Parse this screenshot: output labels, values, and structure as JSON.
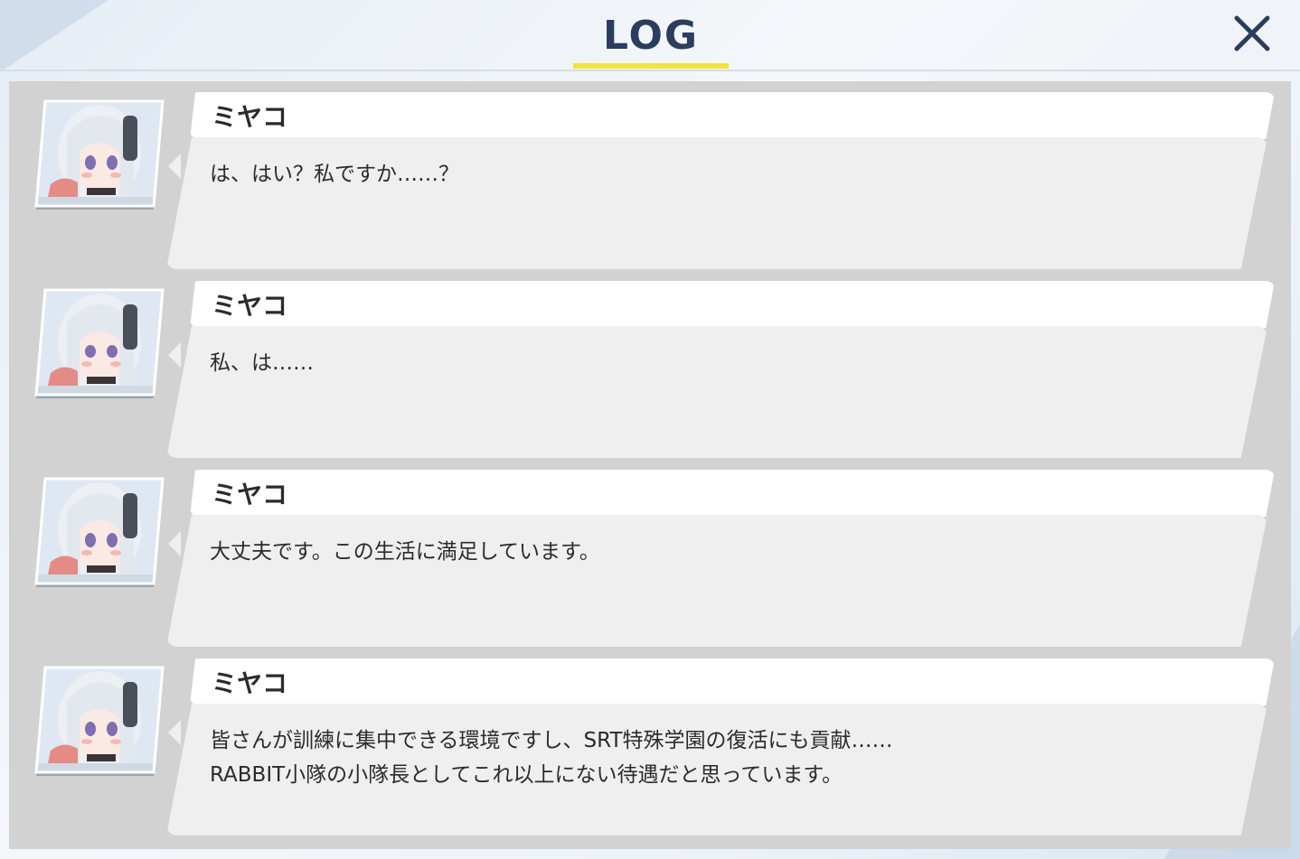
{
  "header": {
    "title": "LOG",
    "close_icon": "close-icon",
    "accent_color": "#f2e33b"
  },
  "entries": [
    {
      "speaker": "ミヤコ",
      "avatar": "character-portrait",
      "message": "は、はい？私ですか……？"
    },
    {
      "speaker": "ミヤコ",
      "avatar": "character-portrait",
      "message": "私、は……"
    },
    {
      "speaker": "ミヤコ",
      "avatar": "character-portrait",
      "message": "大丈夫です。この生活に満足しています。"
    },
    {
      "speaker": "ミヤコ",
      "avatar": "character-portrait",
      "message": "皆さんが訓練に集中できる環境ですし、SRT特殊学園の復活にも貢献……\nRABBIT小隊の小隊長としてこれ以上にない待遇だと思っています。"
    }
  ]
}
